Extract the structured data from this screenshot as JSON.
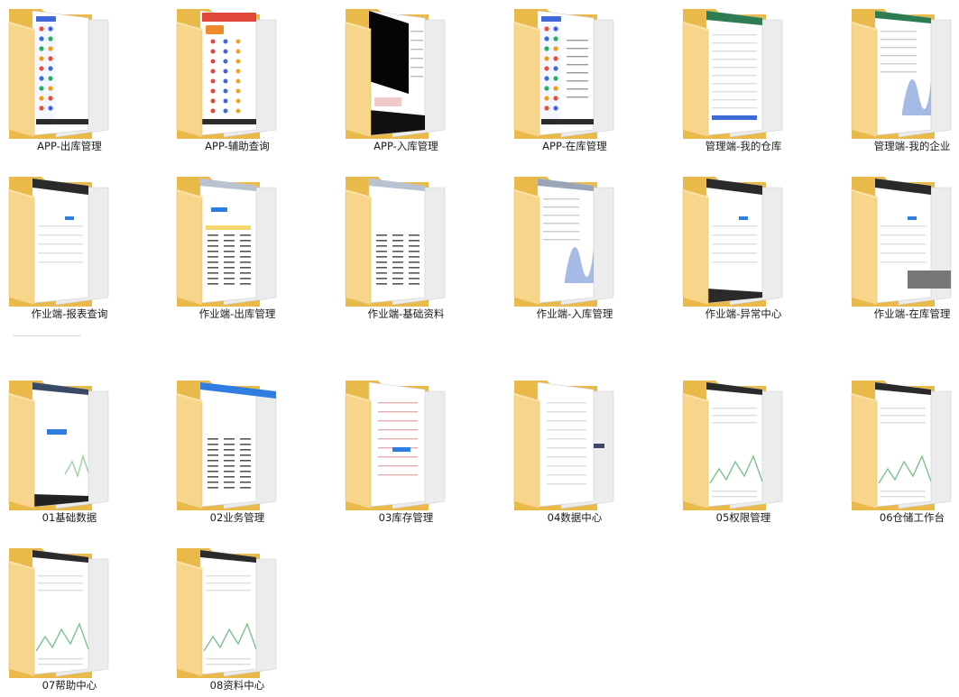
{
  "folders": [
    {
      "name": "APP-出库管理",
      "preview": "mobile"
    },
    {
      "name": "APP-辅助查询",
      "preview": "mobile-red"
    },
    {
      "name": "APP-入库管理",
      "preview": "dark"
    },
    {
      "name": "APP-在库管理",
      "preview": "mobile-doc"
    },
    {
      "name": "管理端-我的仓库",
      "preview": "web-green"
    },
    {
      "name": "管理端-我的企业",
      "preview": "web-chart"
    },
    {
      "name": "作业端-报表查询",
      "preview": "web-dark"
    },
    {
      "name": "作业端-出库管理",
      "preview": "web-table-yellow"
    },
    {
      "name": "作业端-基础资料",
      "preview": "web-table"
    },
    {
      "name": "作业端-入库管理",
      "preview": "web-chart-light"
    },
    {
      "name": "作业端-异常中心",
      "preview": "web-dark-bottom"
    },
    {
      "name": "作业端-在库管理",
      "preview": "web-dark-gray"
    },
    {
      "name": "01基础数据",
      "preview": "web-line-taskbar"
    },
    {
      "name": "02业务管理",
      "preview": "web-blue-table"
    },
    {
      "name": "03库存管理",
      "preview": "web-lines"
    },
    {
      "name": "04数据中心",
      "preview": "web-grid"
    },
    {
      "name": "05权限管理",
      "preview": "web-line-chart"
    },
    {
      "name": "06仓储工作台",
      "preview": "web-line-chart"
    },
    {
      "name": "07帮助中心",
      "preview": "web-line-chart"
    },
    {
      "name": "08资料中心",
      "preview": "web-line-chart"
    }
  ],
  "colors": {
    "folder_back": "#e9b94a",
    "folder_front": "#f7d58a",
    "folder_front_edge": "#e8bf63",
    "paper": "#ffffff",
    "paper_edge": "#d0d0d0"
  }
}
